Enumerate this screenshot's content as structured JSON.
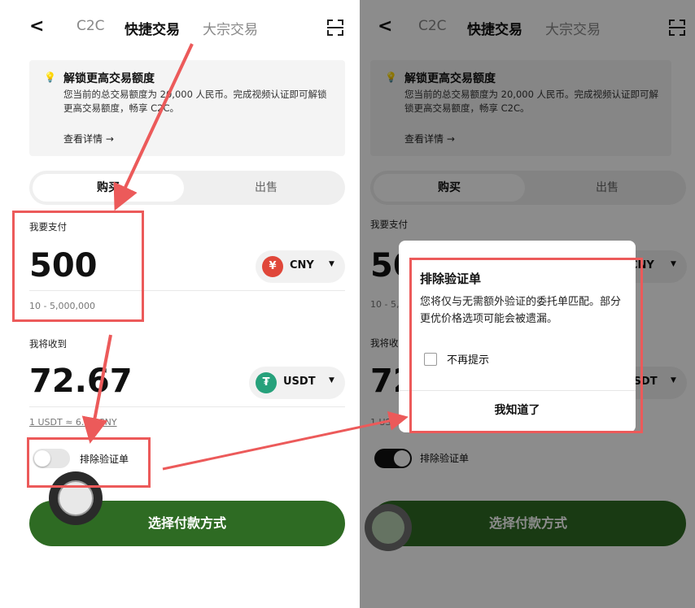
{
  "nav": {
    "back": "<",
    "tab_c2c": "C2C",
    "tab_quick": "快捷交易",
    "tab_bulk": "大宗交易"
  },
  "notice": {
    "title": "解锁更高交易额度",
    "body": "您当前的总交易额度为 20,000 人民币。完成视频认证即可解锁更高交易额度，畅享 C2C。",
    "more": "查看详情 →"
  },
  "segment": {
    "buy": "购买",
    "sell": "出售"
  },
  "pay": {
    "label": "我要支付",
    "amount": "500",
    "currency": "CNY",
    "currency_icon": "¥",
    "range": "10 - 5,000,000"
  },
  "receive": {
    "label": "我将收到",
    "amount": "72.67",
    "currency": "USDT",
    "rate": "1 USDT ≈ 6.88 CNY"
  },
  "toggle": {
    "label": "排除验证单"
  },
  "cta": {
    "label": "选择付款方式"
  },
  "dialog": {
    "title": "排除验证单",
    "message": "您将仅与无需额外验证的委托单匹配。部分更优价格选项可能会被遗漏。",
    "checkbox_label": "不再提示",
    "confirm": "我知道了"
  },
  "colors": {
    "primary_green": "#2e6b23",
    "annotation_red": "#ec5a5a",
    "cny_red": "#e0473a",
    "usdt_teal": "#26a17b"
  }
}
